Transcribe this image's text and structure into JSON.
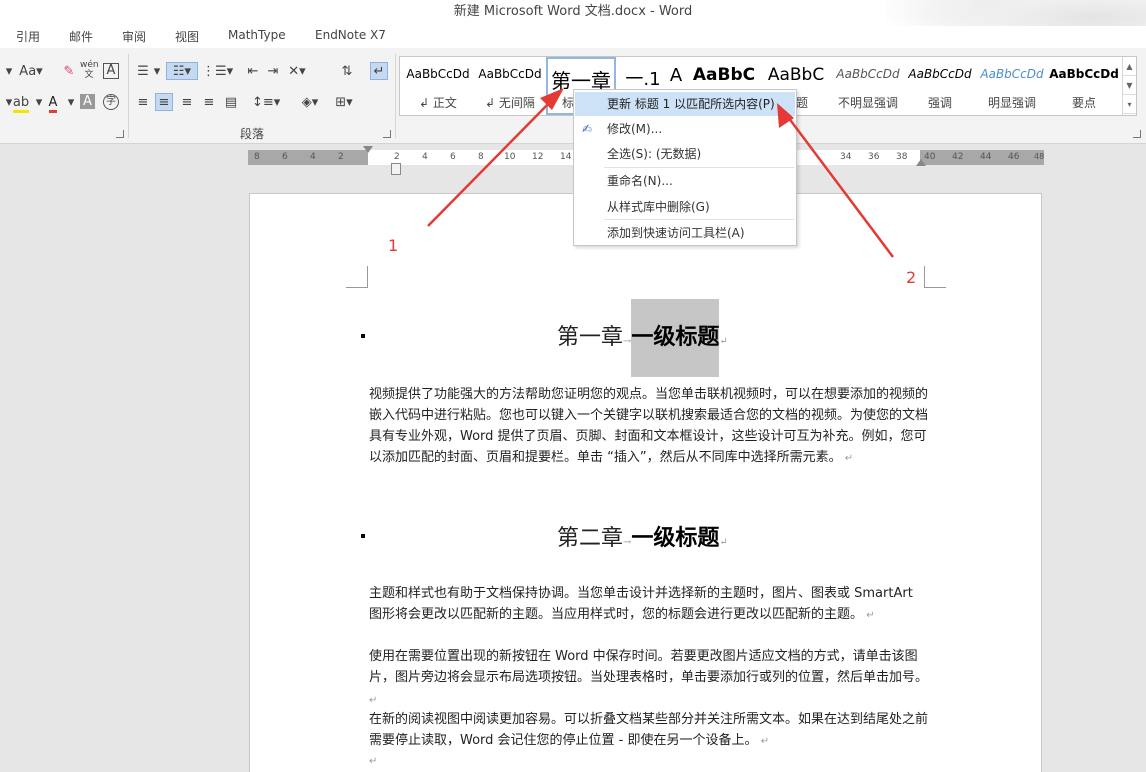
{
  "window": {
    "title": "新建 Microsoft Word 文档.docx - Word"
  },
  "tabs": [
    "引用",
    "邮件",
    "审阅",
    "视图",
    "MathType",
    "EndNote X7"
  ],
  "ribbon": {
    "paragraph_group_label": "段落",
    "font_size_label": "Aa",
    "pinyin_label": "wén"
  },
  "styles": [
    {
      "sample": "AaBbCcDd",
      "name": "正文"
    },
    {
      "sample": "AaBbCcDd",
      "name": "无间隔"
    },
    {
      "sample": "第一章",
      "name": "标"
    },
    {
      "sample": "一.1",
      "name": ""
    },
    {
      "sample": "A",
      "name": ""
    },
    {
      "sample": "AaBbC",
      "name": ""
    },
    {
      "sample": "AaBbC",
      "name": "标题"
    },
    {
      "sample": "AaBbCcDd",
      "name": "不明显强调"
    },
    {
      "sample": "AaBbCcDd",
      "name": "强调"
    },
    {
      "sample": "AaBbCcDd",
      "name": "明显强调"
    },
    {
      "sample": "AaBbCcDd",
      "name": "要点"
    }
  ],
  "ruler": {
    "left_numbers": [
      "8",
      "6",
      "4",
      "2"
    ],
    "right_numbers": [
      "2",
      "4",
      "6",
      "8",
      "10",
      "12",
      "14",
      "34",
      "36",
      "38",
      "40",
      "42",
      "44",
      "46",
      "48"
    ]
  },
  "context_menu": {
    "items": [
      {
        "label": "更新 标题 1 以匹配所选内容(P)",
        "highlighted": true
      },
      {
        "label": "修改(M)..."
      },
      {
        "label": "全选(S): (无数据)"
      },
      {
        "label": "重命名(N)..."
      },
      {
        "label": "从样式库中删除(G)"
      },
      {
        "label": "添加到快速访问工具栏(A)"
      }
    ]
  },
  "document": {
    "heading1_prefix": "第一章",
    "heading1_text": "一级标题",
    "para1": "视频提供了功能强大的方法帮助您证明您的观点。当您单击联机视频时，可以在想要添加的视频的嵌入代码中进行粘贴。您也可以键入一个关键字以联机搜索最适合您的文档的视频。为使您的文档具有专业外观，Word 提供了页眉、页脚、封面和文本框设计，这些设计可互为补充。例如，您可以添加匹配的封面、页眉和提要栏。单击 “插入”，然后从不同库中选择所需元素。",
    "heading2_prefix": "第二章",
    "heading2_text": "一级标题",
    "para2": "主题和样式也有助于文档保持协调。当您单击设计并选择新的主题时，图片、图表或 SmartArt 图形将会更改以匹配新的主题。当应用样式时，您的标题会进行更改以匹配新的主题。",
    "para3": "使用在需要位置出现的新按钮在 Word 中保存时间。若要更改图片适应文档的方式，请单击该图片，图片旁边将会显示布局选项按钮。当处理表格时，单击要添加行或列的位置，然后单击加号。",
    "para4": "在新的阅读视图中阅读更加容易。可以折叠文档某些部分并关注所需文本。如果在达到结尾处之前需要停止读取，Word 会记住您的停止位置 - 即使在另一个设备上。"
  },
  "annotations": {
    "label1": "1",
    "label2": "2",
    "color": "#e53935"
  }
}
